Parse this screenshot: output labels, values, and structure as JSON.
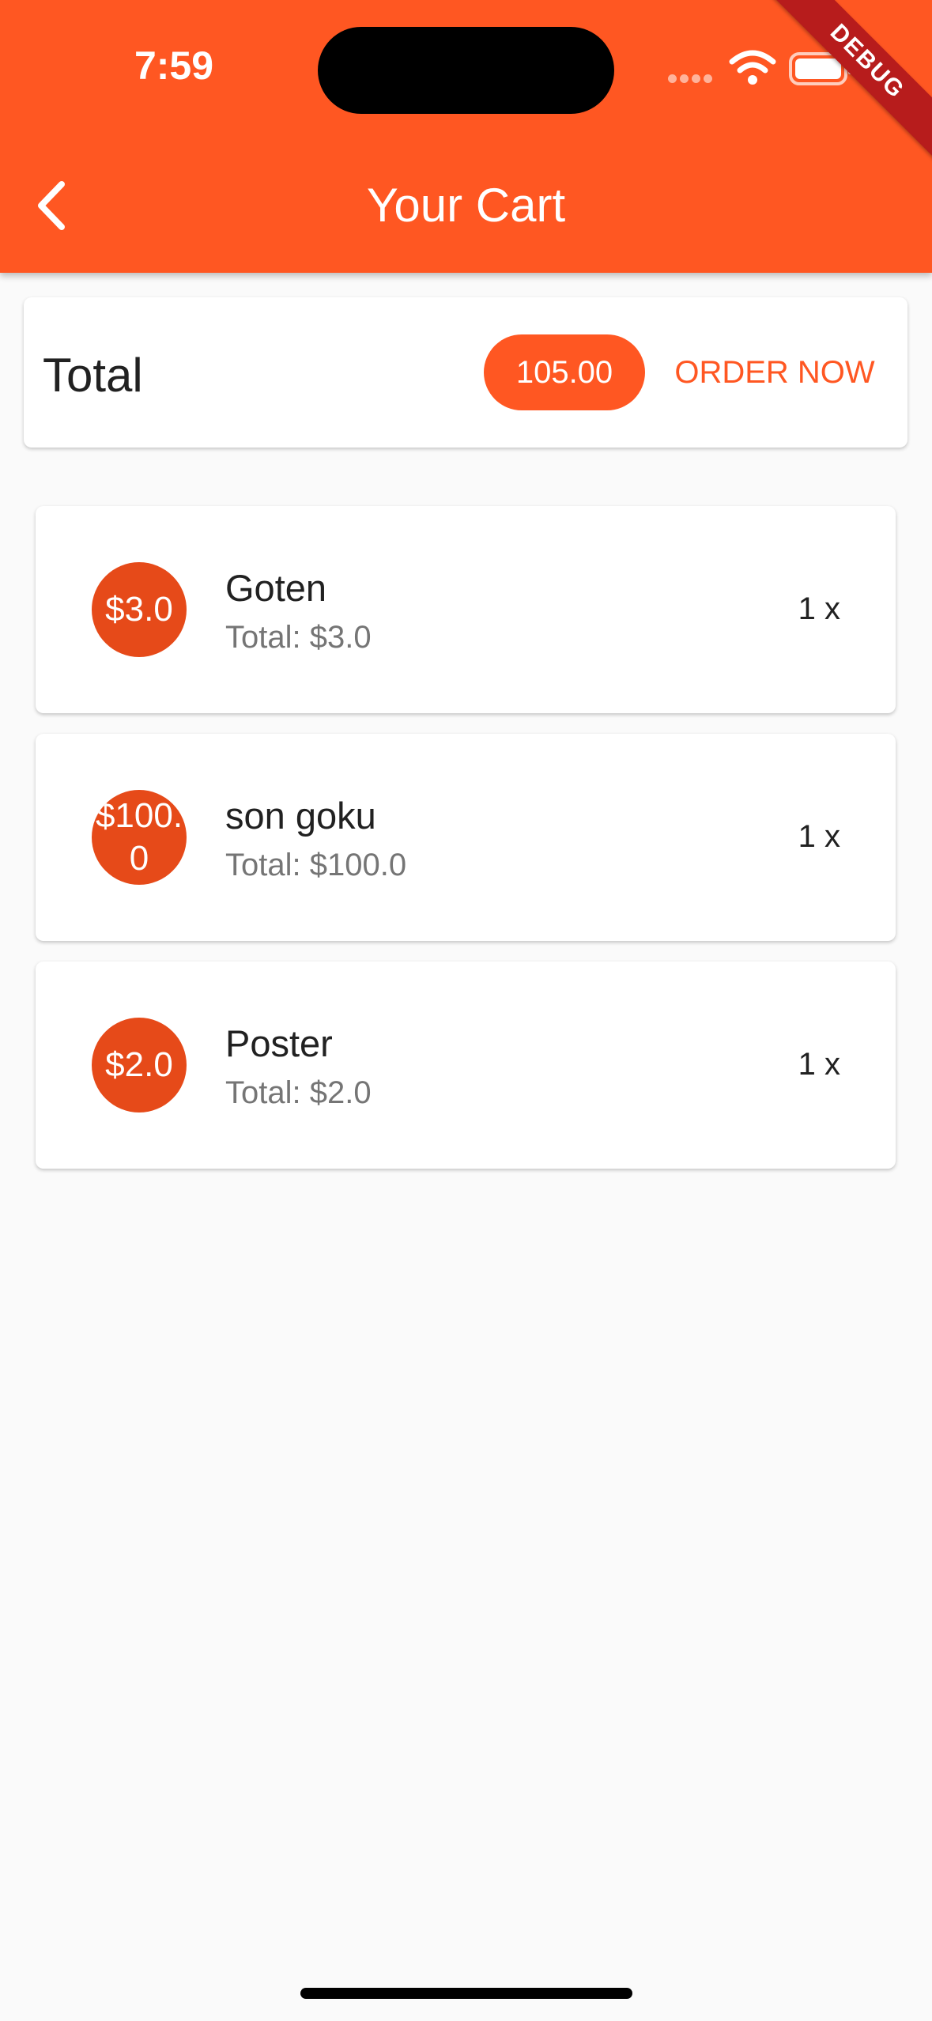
{
  "status_bar": {
    "time": "7:59"
  },
  "debug_banner": "DEBUG",
  "app_bar": {
    "title": "Your Cart",
    "back_icon": "chevron-left-icon"
  },
  "total_card": {
    "label": "Total",
    "amount": "105.00",
    "order_button": "ORDER NOW"
  },
  "cart_items": [
    {
      "avatar": "$3.0",
      "title": "Goten",
      "subtitle": "Total: $3.0",
      "quantity": "1 x"
    },
    {
      "avatar": "$100.0",
      "title": "son goku",
      "subtitle": "Total: $100.0",
      "quantity": "1 x"
    },
    {
      "avatar": "$2.0",
      "title": "Poster",
      "subtitle": "Total: $2.0",
      "quantity": "1 x"
    }
  ],
  "colors": {
    "primary": "#ff5722",
    "avatar": "#e64a19",
    "background": "#fafafa",
    "debug": "#b71c1c"
  }
}
